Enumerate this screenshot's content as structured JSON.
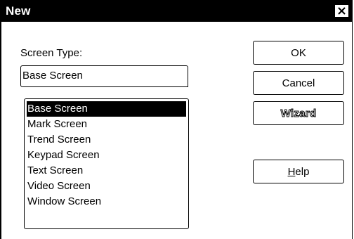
{
  "window": {
    "title": "New",
    "close_label": "×"
  },
  "form": {
    "screen_type_label": "Screen Type:",
    "screen_type_value": "Base Screen"
  },
  "list": {
    "items": [
      "Base Screen",
      "Mark Screen",
      "Trend Screen",
      "Keypad Screen",
      "Text Screen",
      "Video Screen",
      "Window Screen"
    ],
    "selected_index": 0
  },
  "buttons": {
    "ok": "OK",
    "cancel": "Cancel",
    "wizard": "Wizard",
    "help_hotkey": "H",
    "help_rest": "elp"
  },
  "colors": {
    "title_bar": "#000000",
    "selection": "#000000",
    "background": "#ffffff"
  }
}
